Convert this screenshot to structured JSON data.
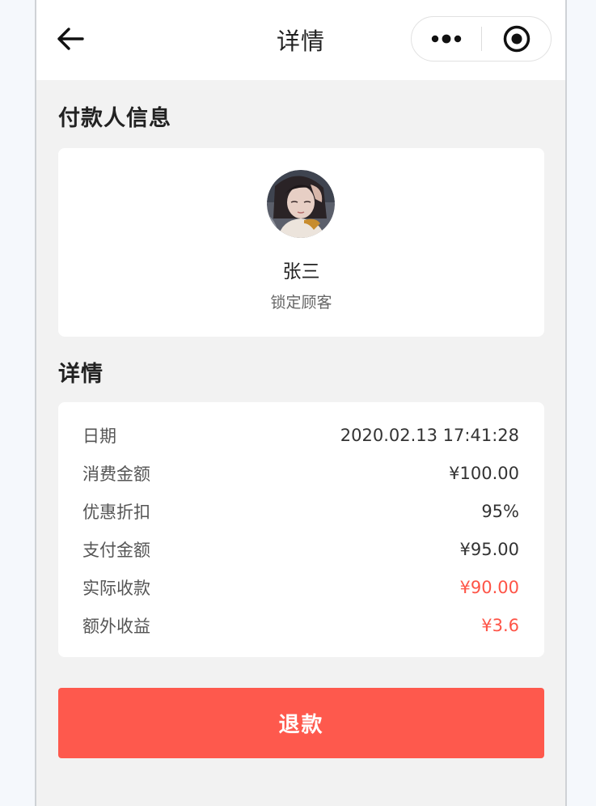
{
  "navbar": {
    "title": "详情",
    "back_icon": "arrow-left-icon",
    "more_icon": "more-dots-icon",
    "close_icon": "target-circle-icon"
  },
  "payer_section": {
    "title": "付款人信息",
    "name": "张三",
    "tag": "锁定顾客",
    "avatar_icon": "avatar-illustration"
  },
  "detail_section": {
    "title": "详情",
    "rows": [
      {
        "label": "日期",
        "value": "2020.02.13 17:41:28",
        "highlight": false
      },
      {
        "label": "消费金额",
        "value": "¥100.00",
        "highlight": false
      },
      {
        "label": "优惠折扣",
        "value": "95%",
        "highlight": false
      },
      {
        "label": "支付金额",
        "value": "¥95.00",
        "highlight": false
      },
      {
        "label": "实际收款",
        "value": "¥90.00",
        "highlight": true
      },
      {
        "label": "额外收益",
        "value": "¥3.6",
        "highlight": true
      }
    ]
  },
  "refund_button": {
    "label": "退款"
  },
  "colors": {
    "accent": "#fe594d",
    "highlight_text": "#fe5447",
    "page_bg": "#f2f2f2",
    "card_bg": "#ffffff"
  }
}
